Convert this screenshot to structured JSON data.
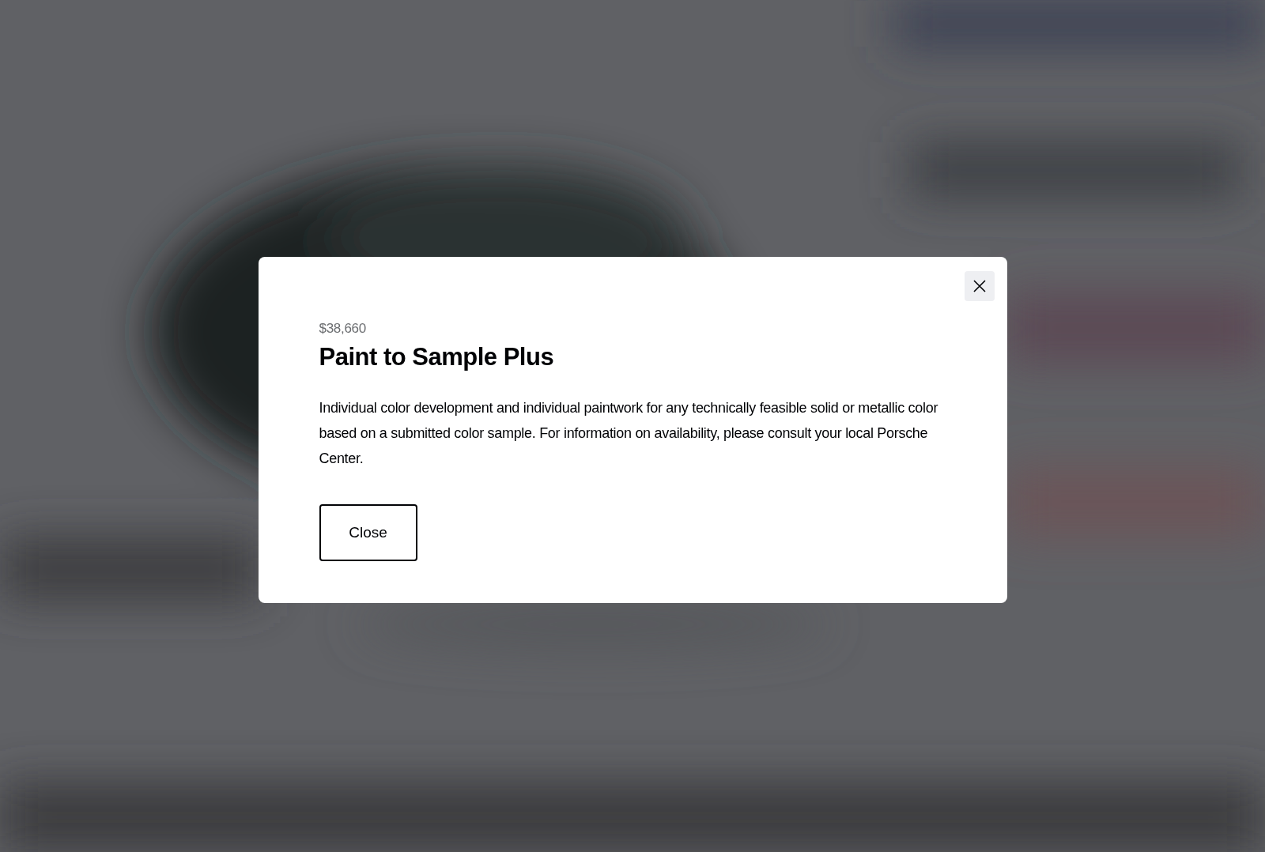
{
  "modal": {
    "price": "$38,660",
    "title": "Paint to Sample Plus",
    "description": "Individual color development and individual paintwork for any technically feasible solid or metallic color based on a submitted color sample. For information on availability, please consult your local Porsche Center.",
    "button": "Close"
  }
}
